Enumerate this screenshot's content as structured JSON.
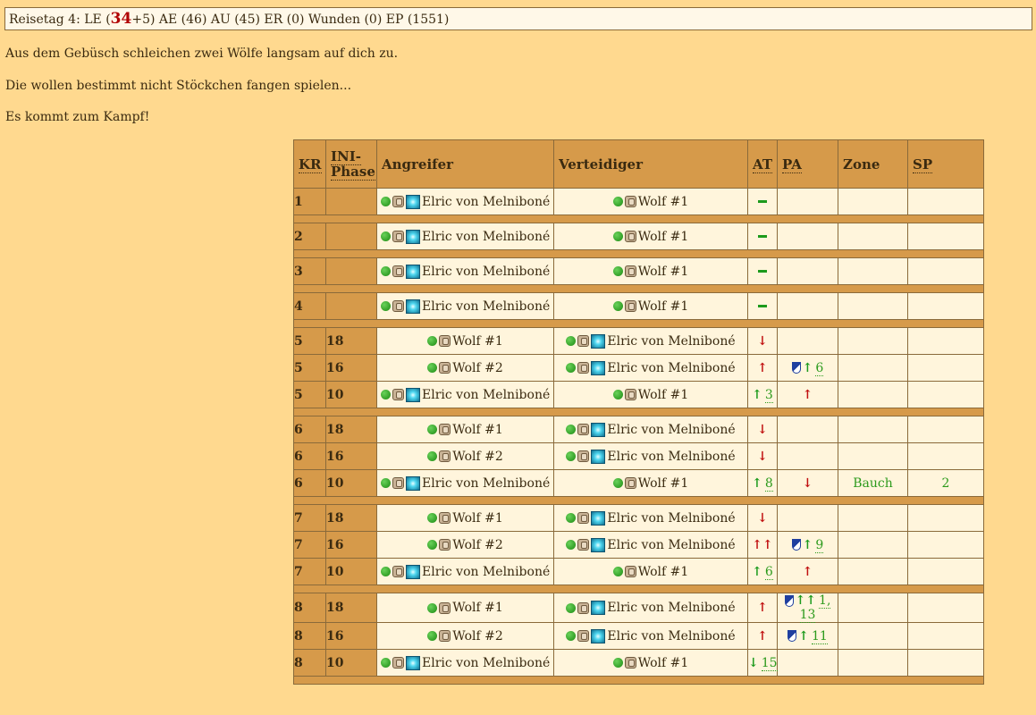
{
  "status": {
    "prefix": "Reisetag 4: LE (",
    "le_value": "34",
    "rest": "+5) AE (46) AU (45) ER (0) Wunden (0) EP (1551)"
  },
  "messages": [
    "Aus dem Gebüsch schleichen zwei Wölfe langsam auf dich zu.",
    "Die wollen bestimmt nicht Stöckchen fangen spielen...",
    "Es kommt zum Kampf!"
  ],
  "table": {
    "headers": {
      "kr": "KR",
      "ini_line1": "INI-",
      "ini_line2": "Phase",
      "angreifer": "Angreifer",
      "verteidiger": "Verteidiger",
      "at": "AT",
      "pa": "PA",
      "zone": "Zone",
      "sp": "SP"
    },
    "icons": {
      "status": "green-ball-icon",
      "gear": "backpack-icon",
      "magic": "magic-burst-icon",
      "shield": "shield-icon"
    },
    "rows": [
      {
        "kr": "1",
        "ini": "",
        "att": "Elric von Melniboné",
        "attHero": true,
        "def": "Wolf #1",
        "defHero": false,
        "at": [
          {
            "t": "dash"
          }
        ],
        "pa": [],
        "zone": "",
        "sp": ""
      },
      {
        "sep": true
      },
      {
        "kr": "2",
        "ini": "",
        "att": "Elric von Melniboné",
        "attHero": true,
        "def": "Wolf #1",
        "defHero": false,
        "at": [
          {
            "t": "dash"
          }
        ],
        "pa": [],
        "zone": "",
        "sp": ""
      },
      {
        "sep": true
      },
      {
        "kr": "3",
        "ini": "",
        "att": "Elric von Melniboné",
        "attHero": true,
        "def": "Wolf #1",
        "defHero": false,
        "at": [
          {
            "t": "dash"
          }
        ],
        "pa": [],
        "zone": "",
        "sp": ""
      },
      {
        "sep": true
      },
      {
        "kr": "4",
        "ini": "",
        "att": "Elric von Melniboné",
        "attHero": true,
        "def": "Wolf #1",
        "defHero": false,
        "at": [
          {
            "t": "dash"
          }
        ],
        "pa": [],
        "zone": "",
        "sp": ""
      },
      {
        "sep": true
      },
      {
        "kr": "5",
        "ini": "18",
        "att": "Wolf #1",
        "attHero": false,
        "def": "Elric von Melniboné",
        "defHero": true,
        "at": [
          {
            "t": "down-red"
          }
        ],
        "pa": [],
        "zone": "",
        "sp": ""
      },
      {
        "kr": "5",
        "ini": "16",
        "att": "Wolf #2",
        "attHero": false,
        "def": "Elric von Melniboné",
        "defHero": true,
        "at": [
          {
            "t": "up-red"
          }
        ],
        "pa": [
          {
            "t": "shield"
          },
          {
            "t": "up-green"
          },
          {
            "t": "num",
            "v": "6"
          }
        ],
        "zone": "",
        "sp": ""
      },
      {
        "kr": "5",
        "ini": "10",
        "att": "Elric von Melniboné",
        "attHero": true,
        "def": "Wolf #1",
        "defHero": false,
        "at": [
          {
            "t": "up-green"
          },
          {
            "t": "num",
            "v": "3"
          }
        ],
        "pa": [
          {
            "t": "up-red"
          }
        ],
        "zone": "",
        "sp": ""
      },
      {
        "sep": true
      },
      {
        "kr": "6",
        "ini": "18",
        "att": "Wolf #1",
        "attHero": false,
        "def": "Elric von Melniboné",
        "defHero": true,
        "at": [
          {
            "t": "down-red"
          }
        ],
        "pa": [],
        "zone": "",
        "sp": ""
      },
      {
        "kr": "6",
        "ini": "16",
        "att": "Wolf #2",
        "attHero": false,
        "def": "Elric von Melniboné",
        "defHero": true,
        "at": [
          {
            "t": "down-red"
          }
        ],
        "pa": [],
        "zone": "",
        "sp": ""
      },
      {
        "kr": "6",
        "ini": "10",
        "att": "Elric von Melniboné",
        "attHero": true,
        "def": "Wolf #1",
        "defHero": false,
        "at": [
          {
            "t": "up-green"
          },
          {
            "t": "num",
            "v": "8"
          }
        ],
        "pa": [
          {
            "t": "down-red"
          }
        ],
        "zone": "Bauch",
        "sp": "2"
      },
      {
        "sep": true
      },
      {
        "kr": "7",
        "ini": "18",
        "att": "Wolf #1",
        "attHero": false,
        "def": "Elric von Melniboné",
        "defHero": true,
        "at": [
          {
            "t": "down-red"
          }
        ],
        "pa": [],
        "zone": "",
        "sp": ""
      },
      {
        "kr": "7",
        "ini": "16",
        "att": "Wolf #2",
        "attHero": false,
        "def": "Elric von Melniboné",
        "defHero": true,
        "at": [
          {
            "t": "up-red"
          },
          {
            "t": "up-red"
          }
        ],
        "pa": [
          {
            "t": "shield"
          },
          {
            "t": "up-green"
          },
          {
            "t": "num",
            "v": "9"
          }
        ],
        "zone": "",
        "sp": ""
      },
      {
        "kr": "7",
        "ini": "10",
        "att": "Elric von Melniboné",
        "attHero": true,
        "def": "Wolf #1",
        "defHero": false,
        "at": [
          {
            "t": "up-green"
          },
          {
            "t": "num",
            "v": "6"
          }
        ],
        "pa": [
          {
            "t": "up-red"
          }
        ],
        "zone": "",
        "sp": ""
      },
      {
        "sep": true
      },
      {
        "kr": "8",
        "ini": "18",
        "att": "Wolf #1",
        "attHero": false,
        "def": "Elric von Melniboné",
        "defHero": true,
        "at": [
          {
            "t": "up-red"
          }
        ],
        "pa": [
          {
            "t": "shield"
          },
          {
            "t": "up-green"
          },
          {
            "t": "up-green"
          },
          {
            "t": "num",
            "v": "1, 13"
          }
        ],
        "zone": "",
        "sp": ""
      },
      {
        "kr": "8",
        "ini": "16",
        "att": "Wolf #2",
        "attHero": false,
        "def": "Elric von Melniboné",
        "defHero": true,
        "at": [
          {
            "t": "up-red"
          }
        ],
        "pa": [
          {
            "t": "shield"
          },
          {
            "t": "up-green"
          },
          {
            "t": "num",
            "v": "11"
          }
        ],
        "zone": "",
        "sp": ""
      },
      {
        "kr": "8",
        "ini": "10",
        "att": "Elric von Melniboné",
        "attHero": true,
        "def": "Wolf #1",
        "defHero": false,
        "at": [
          {
            "t": "down-green"
          },
          {
            "t": "num",
            "v": "15"
          }
        ],
        "pa": [],
        "zone": "",
        "sp": ""
      },
      {
        "sep": true
      }
    ]
  }
}
